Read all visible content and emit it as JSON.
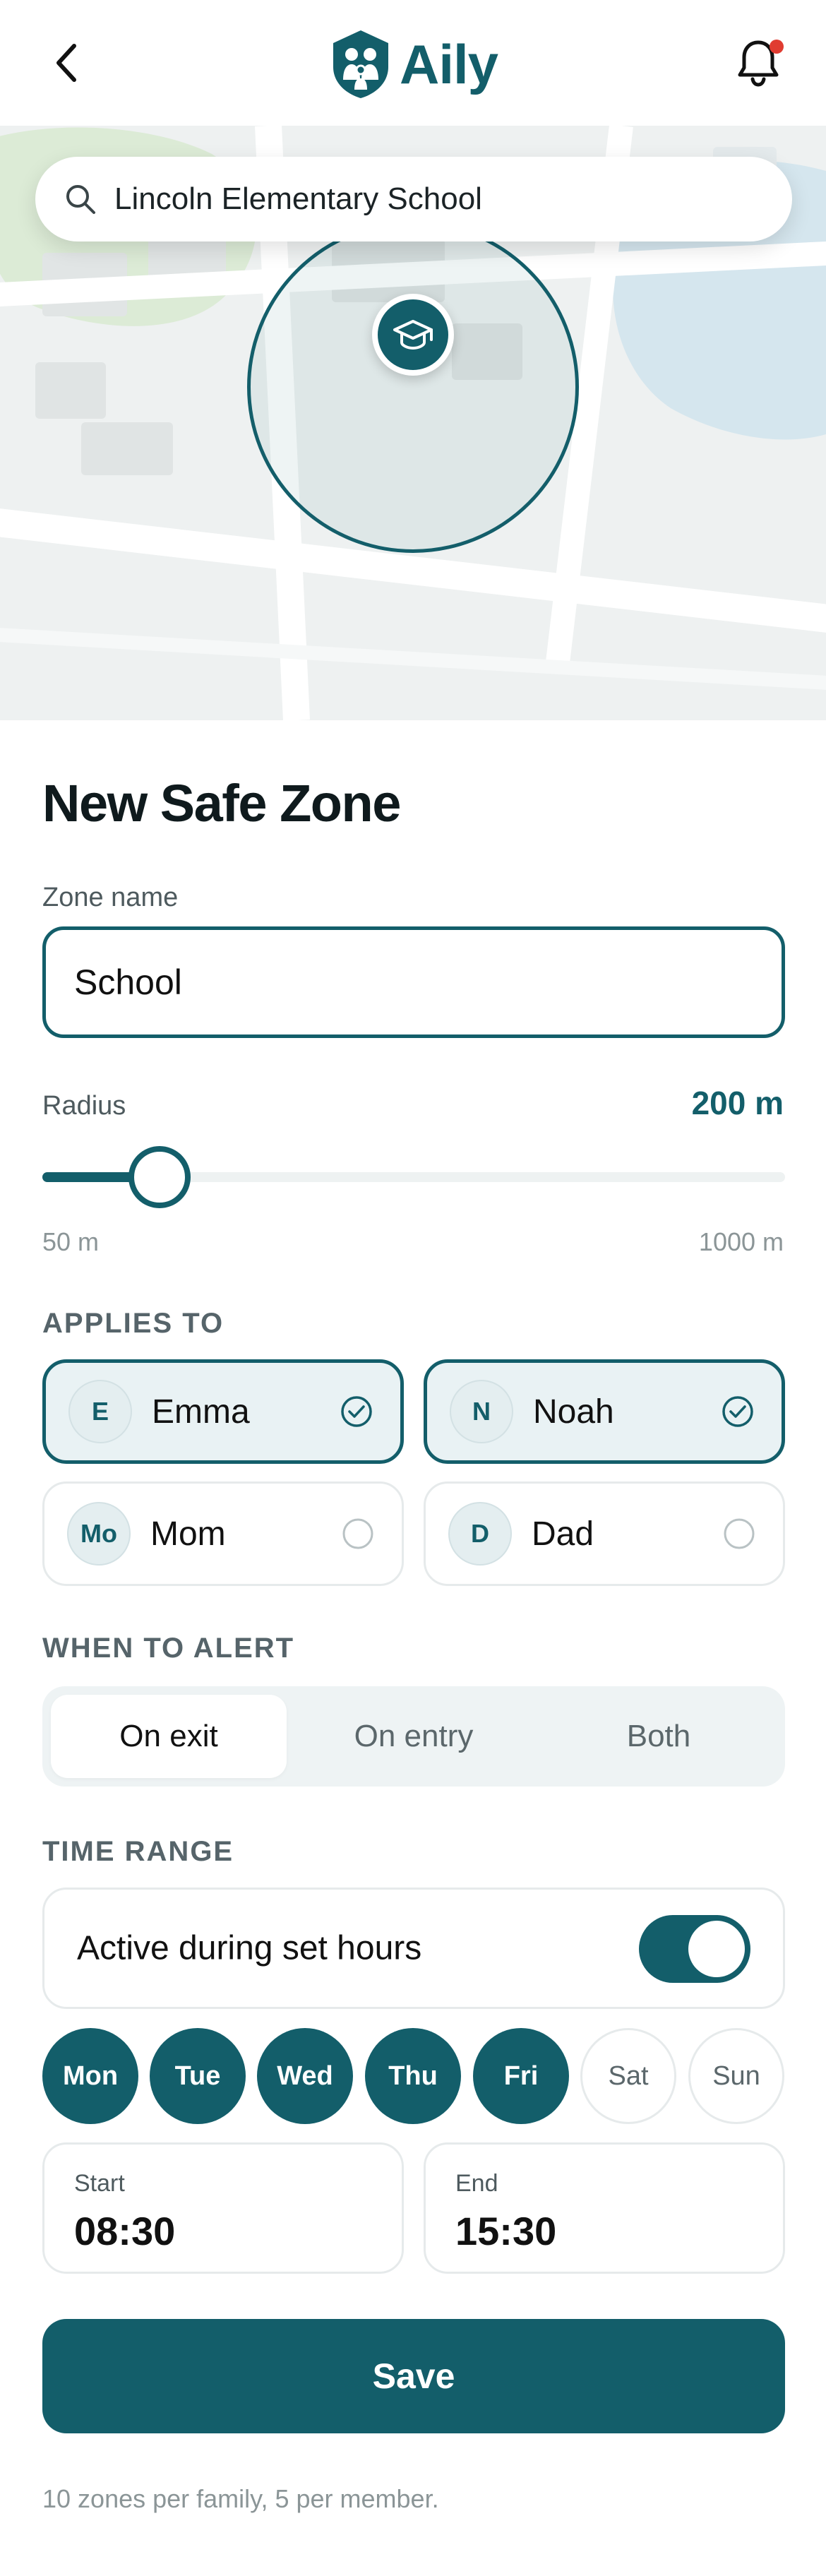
{
  "header": {
    "app_name": "Aily",
    "back_icon": "chevron-left-icon",
    "bell_icon": "bell-icon",
    "has_notification": true
  },
  "map": {
    "search_value": "Lincoln Elementary School",
    "marker_icon": "graduation-cap-icon"
  },
  "form": {
    "title": "New Safe Zone",
    "zone_name_label": "Zone name",
    "zone_name_value": "School",
    "radius_label": "Radius",
    "radius_value": "200 m",
    "radius_min_label": "50 m",
    "radius_max_label": "1000 m",
    "radius_fraction": 0.1579
  },
  "applies_to": {
    "heading": "APPLIES TO",
    "members": [
      {
        "initial": "E",
        "name": "Emma",
        "selected": true
      },
      {
        "initial": "N",
        "name": "Noah",
        "selected": true
      },
      {
        "initial": "Mo",
        "name": "Mom",
        "selected": false
      },
      {
        "initial": "D",
        "name": "Dad",
        "selected": false
      }
    ]
  },
  "alert": {
    "heading": "WHEN TO ALERT",
    "options": [
      "On exit",
      "On entry",
      "Both"
    ],
    "selected_index": 0
  },
  "time_range": {
    "heading": "TIME RANGE",
    "toggle_label": "Active during set hours",
    "toggle_on": true,
    "days": [
      {
        "label": "Mon",
        "on": true
      },
      {
        "label": "Tue",
        "on": true
      },
      {
        "label": "Wed",
        "on": true
      },
      {
        "label": "Thu",
        "on": true
      },
      {
        "label": "Fri",
        "on": true
      },
      {
        "label": "Sat",
        "on": false
      },
      {
        "label": "Sun",
        "on": false
      }
    ],
    "start_label": "Start",
    "start_value": "08:30",
    "end_label": "End",
    "end_value": "15:30"
  },
  "actions": {
    "save_label": "Save",
    "footnote": "10 zones per family, 5 per member."
  },
  "colors": {
    "brand": "#135e6a",
    "notification": "#e03c31"
  }
}
